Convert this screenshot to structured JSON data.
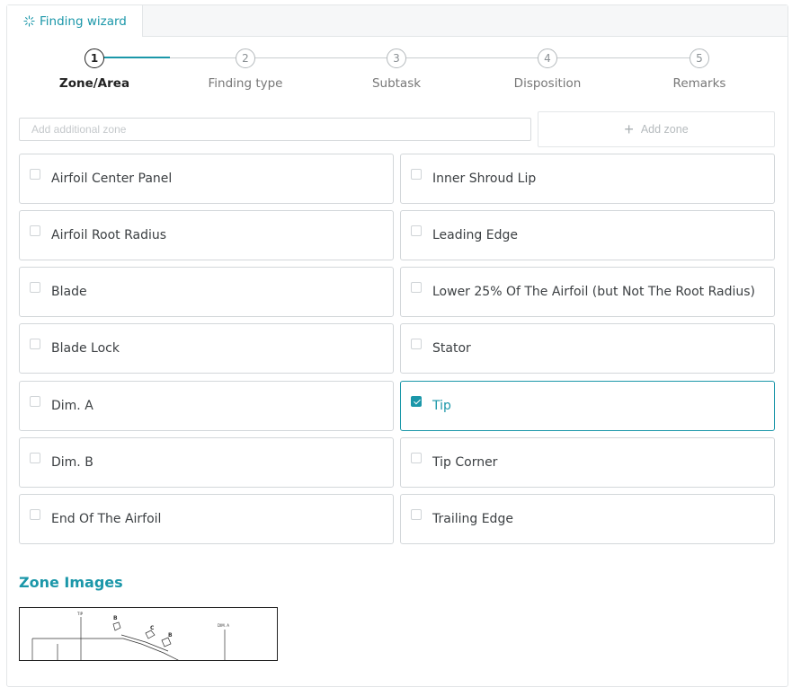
{
  "tab": {
    "label": "Finding wizard",
    "icon": "sparkle-icon"
  },
  "stepper": {
    "steps": [
      {
        "number": "1",
        "label": "Zone/Area",
        "current": true
      },
      {
        "number": "2",
        "label": "Finding type",
        "current": false
      },
      {
        "number": "3",
        "label": "Subtask",
        "current": false
      },
      {
        "number": "4",
        "label": "Disposition",
        "current": false
      },
      {
        "number": "5",
        "label": "Remarks",
        "current": false
      }
    ]
  },
  "zone_input": {
    "placeholder": "Add additional zone",
    "value": ""
  },
  "add_zone": {
    "label": "Add zone"
  },
  "zones": {
    "left": [
      {
        "label": "Airfoil Center Panel",
        "checked": false
      },
      {
        "label": "Airfoil Root Radius",
        "checked": false
      },
      {
        "label": "Blade",
        "checked": false
      },
      {
        "label": "Blade Lock",
        "checked": false
      },
      {
        "label": "Dim. A",
        "checked": false
      },
      {
        "label": "Dim. B",
        "checked": false
      },
      {
        "label": "End Of The Airfoil",
        "checked": false
      }
    ],
    "right": [
      {
        "label": "Inner Shroud Lip",
        "checked": false
      },
      {
        "label": "Leading Edge",
        "checked": false
      },
      {
        "label": "Lower 25% Of The Airfoil (but Not The Root Radius)",
        "checked": false
      },
      {
        "label": "Stator",
        "checked": false
      },
      {
        "label": "Tip",
        "checked": true
      },
      {
        "label": "Tip Corner",
        "checked": false
      },
      {
        "label": "Trailing Edge",
        "checked": false
      }
    ]
  },
  "zone_images": {
    "title": "Zone Images",
    "drawing_labels": [
      "TIP",
      "B",
      "C",
      "B",
      "DIM. A"
    ]
  },
  "colors": {
    "accent": "#1b97a9",
    "border": "#d3d7da"
  }
}
